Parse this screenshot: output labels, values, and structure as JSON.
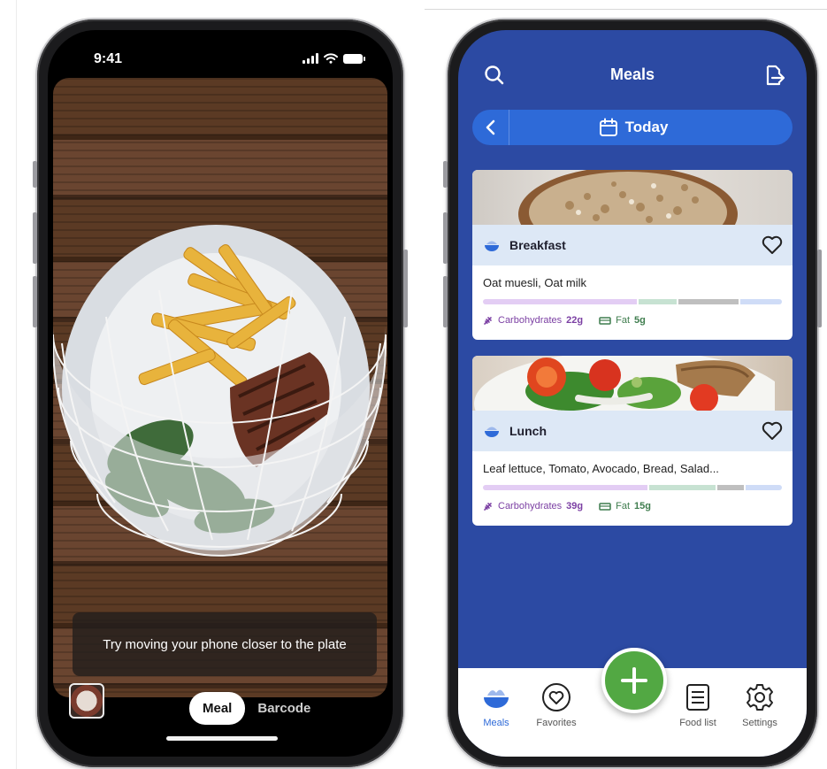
{
  "left_phone": {
    "status_time": "9:41",
    "hint_text": "Try moving your phone closer to the plate",
    "mode_active": "Meal",
    "mode_inactive": "Barcode",
    "icons": [
      "signal-icon",
      "wifi-icon",
      "battery-icon",
      "meal-thumbnail"
    ]
  },
  "right_phone": {
    "header": {
      "title": "Meals",
      "left_icon": "search-icon",
      "right_icon": "export-icon"
    },
    "date_bar": {
      "label": "Today",
      "back_icon": "chevron-left-icon",
      "calendar_icon": "calendar-icon"
    },
    "meals": [
      {
        "name": "Breakfast",
        "foods": "Oat muesli, Oat milk",
        "carbs_label": "Carbohydrates",
        "carbs_value": "22g",
        "fat_label": "Fat",
        "fat_value": "5g",
        "macro_split": [
          0.56,
          0.14,
          0.22,
          0.15
        ],
        "photo": "oat muesli bowl"
      },
      {
        "name": "Lunch",
        "foods": "Leaf lettuce, Tomato, Avocado, Bread, Salad...",
        "carbs_label": "Carbohydrates",
        "carbs_value": "39g",
        "fat_label": "Fat",
        "fat_value": "15g",
        "macro_split": [
          0.55,
          0.22,
          0.09,
          0.12
        ],
        "photo": "salad with tomato and bread"
      }
    ],
    "tabs": [
      {
        "label": "Meals",
        "icon": "bowl-icon",
        "active": true
      },
      {
        "label": "Favorites",
        "icon": "heart-icon",
        "active": false
      },
      {
        "label": "Food list",
        "icon": "list-icon",
        "active": false
      },
      {
        "label": "Settings",
        "icon": "gear-icon",
        "active": false
      }
    ],
    "fab_icon": "plus-icon"
  },
  "colors": {
    "app_blue": "#2c4aa3",
    "accent_blue": "#2e6ad8",
    "card_header": "#dde8f6",
    "fab_green": "#52a843",
    "carbs": "#e3cdf4",
    "protein": "#c7e2d2",
    "fat": "#bfbfbf",
    "other": "#cfdcf7"
  }
}
